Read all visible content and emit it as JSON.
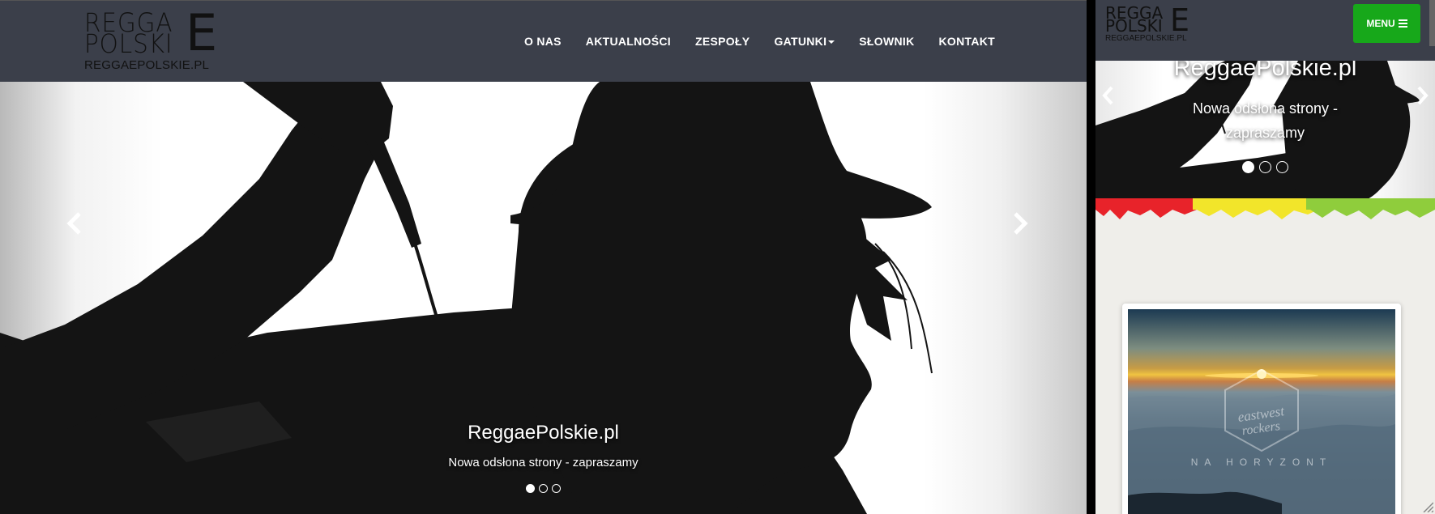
{
  "desktop": {
    "logo": {
      "line1": "REGGA",
      "line2": "POLSKI",
      "big_letter": "E",
      "domain": "REGGAEPOLSKIE.PL"
    },
    "nav": [
      {
        "label": "O NAS"
      },
      {
        "label": "AKTUALNOŚCI"
      },
      {
        "label": "ZESPOŁY"
      },
      {
        "label": "GATUNKI",
        "dropdown": true
      },
      {
        "label": "SŁOWNIK"
      },
      {
        "label": "KONTAKT"
      }
    ],
    "carousel": {
      "title": "ReggaePolskie.pl",
      "subtitle": "Nowa odsłona strony - zapraszamy",
      "slide_count": 3,
      "active_slide": 1,
      "prev_icon": "chevron-left-icon",
      "next_icon": "chevron-right-icon"
    }
  },
  "mobile": {
    "logo": {
      "line1": "REGGA",
      "line2": "POLSKI",
      "big_letter": "E",
      "domain": "REGGAEPOLSKIE.PL"
    },
    "menu_button": {
      "label": "MENU",
      "icon": "hamburger-icon",
      "color": "#17a81a"
    },
    "carousel": {
      "title": "ReggaePolskie.pl",
      "subtitle_line1": "Nowa odsłona strony -",
      "subtitle_line2": "zapraszamy"
    },
    "album_card": {
      "cover_text": "NA HORYZONT"
    }
  },
  "colors": {
    "navbar": "#3b3f4a",
    "menu_green": "#17a81a",
    "stripe_red": "#e8232a",
    "stripe_yellow": "#f2e52a",
    "stripe_green": "#8fcd3c"
  }
}
